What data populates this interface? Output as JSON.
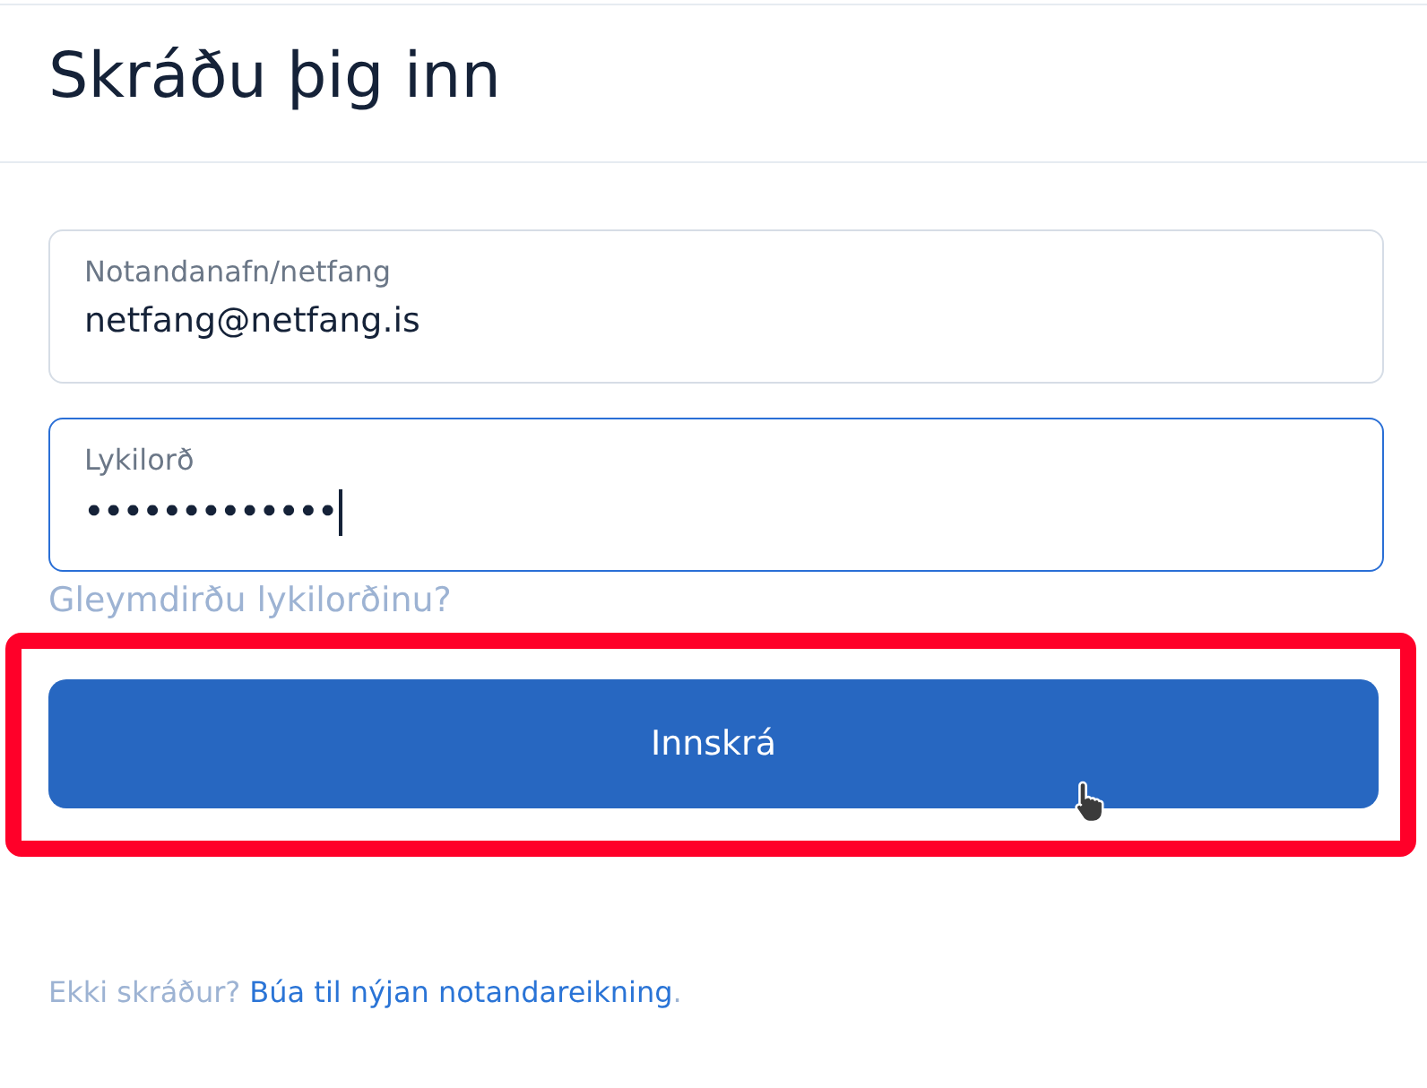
{
  "title": "Skráðu þig inn",
  "fields": [
    {
      "label": "Notandanafn/netfang",
      "value": "netfang@netfang.is",
      "kind": "text",
      "focused": false
    },
    {
      "label": "Lykilorð",
      "value": "•••••••••••••",
      "kind": "password",
      "focused": true
    }
  ],
  "forgot_link": "Gleymdirðu lykilorðinu?",
  "submit_button": {
    "label": "Innskrá",
    "highlighted": true,
    "hovered": true
  },
  "signup": {
    "prompt": "Ekki skráður?",
    "link": "Búa til nýjan notandareikning",
    "suffix": "."
  }
}
